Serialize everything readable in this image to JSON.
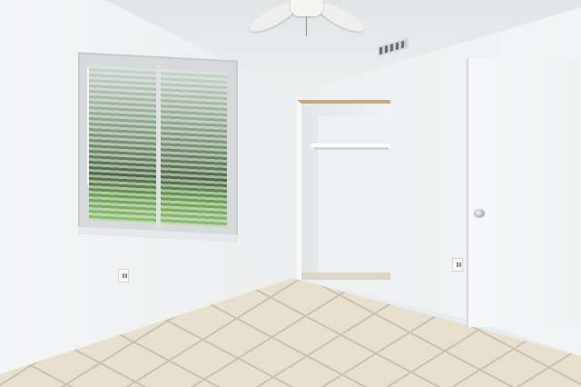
{
  "scene": {
    "description_type": "photo",
    "room": "empty bedroom",
    "colors": {
      "walls": "#eceeef",
      "floor_tile": "#e7e0cf",
      "grout": "#c9c2b2",
      "closet_trim": "#c7a884"
    },
    "objects": [
      "ceiling-fan",
      "air-vent",
      "window-with-blinds",
      "open-closet",
      "closet-rod",
      "door",
      "door-knob",
      "wall-outlet",
      "tile-floor"
    ]
  }
}
